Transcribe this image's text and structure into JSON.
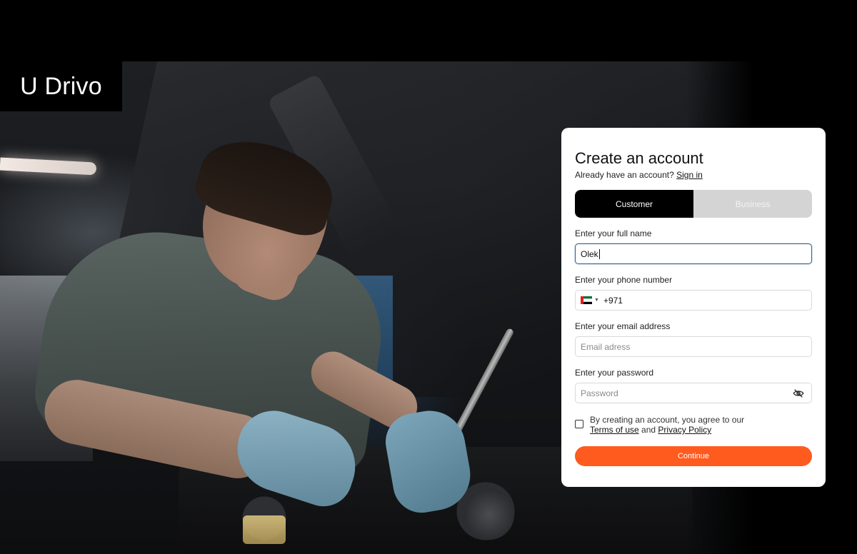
{
  "brand": {
    "name": "U Drivo"
  },
  "form": {
    "title": "Create an account",
    "signin_prompt": "Already have an account?",
    "signin_link": "Sign in",
    "tabs": [
      {
        "label": "Customer",
        "active": true
      },
      {
        "label": "Business",
        "active": false
      }
    ],
    "full_name": {
      "label": "Enter your full name",
      "value": "Olek"
    },
    "phone": {
      "label": "Enter your phone number",
      "country_code": "+971",
      "flag_icon": "uae-flag-icon"
    },
    "email": {
      "label": "Enter your email address",
      "placeholder": "Email adress",
      "value": ""
    },
    "password": {
      "label": "Enter your password",
      "placeholder": "Password",
      "value": "",
      "toggle_icon": "eye-slash-icon"
    },
    "terms": {
      "prefix": "By creating an account, you agree to our",
      "terms_link": "Terms of use",
      "joiner": "and",
      "privacy_link": "Privacy Policy",
      "checked": false
    },
    "continue_label": "Continue"
  },
  "colors": {
    "accent": "#ff5b1f",
    "active_tab": "#000000",
    "inactive_tab": "#d4d4d4",
    "focus_border": "#2f5f8a"
  }
}
